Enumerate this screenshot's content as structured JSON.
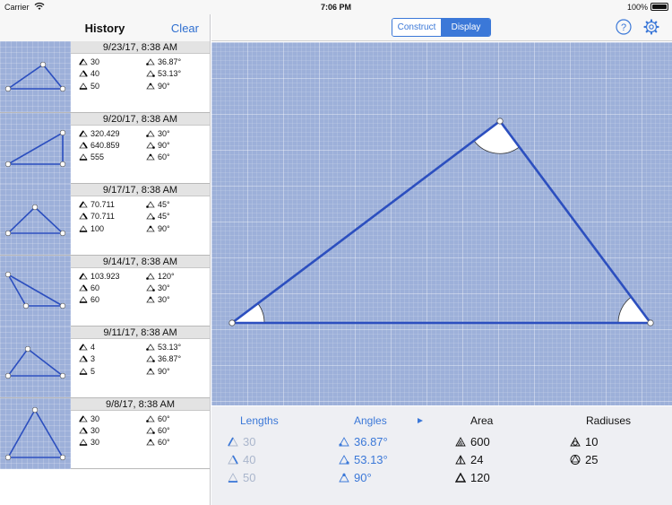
{
  "status_bar": {
    "carrier": "Carrier",
    "time": "7:06 PM",
    "battery": "100%"
  },
  "history": {
    "title": "History",
    "clear_label": "Clear",
    "entries": [
      {
        "date": "9/23/17, 8:38 AM",
        "lengths": [
          "30",
          "40",
          "50"
        ],
        "angles": [
          "36.87°",
          "53.13°",
          "90°"
        ]
      },
      {
        "date": "9/20/17, 8:38 AM",
        "lengths": [
          "320.429",
          "640.859",
          "555"
        ],
        "angles": [
          "30°",
          "90°",
          "60°"
        ]
      },
      {
        "date": "9/17/17, 8:38 AM",
        "lengths": [
          "70.711",
          "70.711",
          "100"
        ],
        "angles": [
          "45°",
          "45°",
          "90°"
        ]
      },
      {
        "date": "9/14/17, 8:38 AM",
        "lengths": [
          "103.923",
          "60",
          "60"
        ],
        "angles": [
          "120°",
          "30°",
          "30°"
        ]
      },
      {
        "date": "9/11/17, 8:38 AM",
        "lengths": [
          "4",
          "3",
          "5"
        ],
        "angles": [
          "53.13°",
          "36.87°",
          "90°"
        ]
      },
      {
        "date": "9/8/17, 8:38 AM",
        "lengths": [
          "30",
          "30",
          "30"
        ],
        "angles": [
          "60°",
          "60°",
          "60°"
        ]
      }
    ]
  },
  "toolbar": {
    "construct_label": "Construct",
    "display_label": "Display",
    "active_mode": "Display",
    "help_icon": "help-icon",
    "settings_icon": "gear-icon"
  },
  "measurements": {
    "lengths_header": "Lengths",
    "angles_header": "Angles",
    "area_header": "Area",
    "radii_header": "Radiuses",
    "lengths": [
      "30",
      "40",
      "50"
    ],
    "angles": [
      "36.87°",
      "53.13°",
      "90°"
    ],
    "area": [
      "600",
      "24",
      "120"
    ],
    "radii": [
      "10",
      "25"
    ]
  },
  "colors": {
    "accent": "#3b78d8",
    "grid": "#9db0d9",
    "triangle_line": "#2c4fbf"
  }
}
